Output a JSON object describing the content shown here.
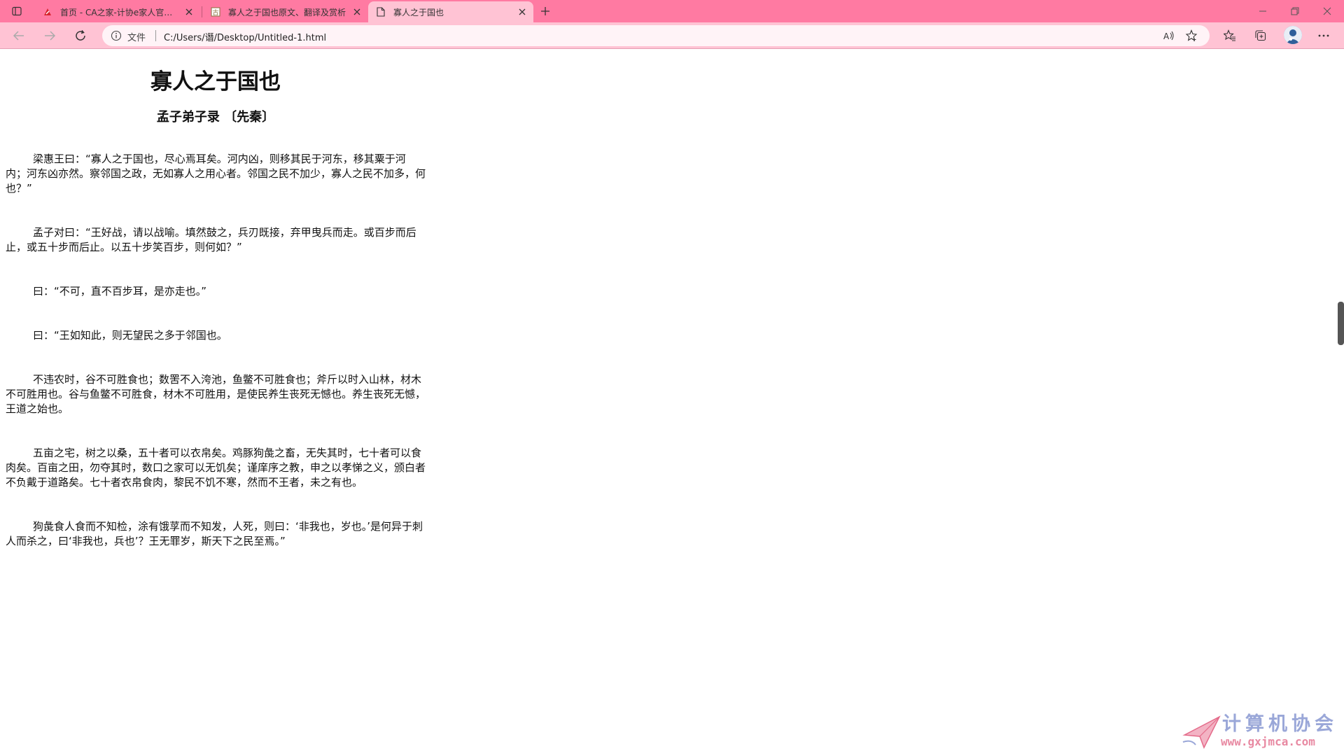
{
  "tabs": [
    {
      "title": "首页 - CA之家-计协e家人官方网站",
      "active": false
    },
    {
      "title": "寡人之于国也原文、翻译及赏析",
      "active": false
    },
    {
      "title": "寡人之于国也",
      "active": true
    }
  ],
  "address": {
    "label": "文件",
    "url": "C:/Users/谮/Desktop/Untitled-1.html"
  },
  "article": {
    "title": "寡人之于国也",
    "author": "孟子弟子录 〔先秦〕",
    "paragraphs": [
      "梁惠王曰：“寡人之于国也，尽心焉耳矣。河内凶，则移其民于河东，移其粟于河内；河东凶亦然。察邻国之政，无如寡人之用心者。邻国之民不加少，寡人之民不加多，何也？”",
      "孟子对曰：“王好战，请以战喻。填然鼓之，兵刃既接，弃甲曳兵而走。或百步而后止，或五十步而后止。以五十步笑百步，则何如？”",
      "曰：“不可，直不百步耳，是亦走也。”",
      "曰：“王如知此，则无望民之多于邻国也。",
      "不违农时，谷不可胜食也；数罟不入洿池，鱼鳖不可胜食也；斧斤以时入山林，材木不可胜用也。谷与鱼鳖不可胜食，材木不可胜用，是使民养生丧死无憾也。养生丧死无憾，王道之始也。",
      "五亩之宅，树之以桑，五十者可以衣帛矣。鸡豚狗彘之畜，无失其时，七十者可以食肉矣。百亩之田，勿夺其时，数口之家可以无饥矣；谨庠序之教，申之以孝悌之义，颁白者不负戴于道路矣。七十者衣帛食肉，黎民不饥不寒，然而不王者，未之有也。",
      "狗彘食人食而不知检，涂有饿莩而不知发，人死，则曰：‘非我也，岁也。’是何异于刺人而杀之，曰‘非我也，兵也’？王无罪岁，斯天下之民至焉。”"
    ]
  },
  "watermark": {
    "text_cn": "计算机协会",
    "text_url": "www.gxjmca.com"
  },
  "colors": {
    "tabstrip": "#ff7aa2",
    "toolbar": "#ffc3d4",
    "active_tab": "#ffc3d4"
  }
}
